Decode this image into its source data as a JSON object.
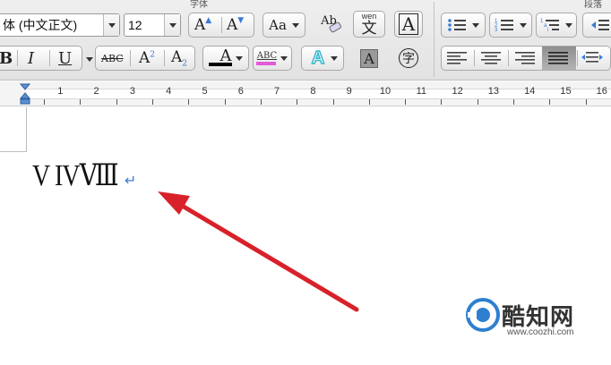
{
  "ribbon": {
    "font_group_title": "字体",
    "paragraph_group_title": "段落",
    "font_name": "体 (中文正文)",
    "font_size": "12",
    "grow_font": "A",
    "shrink_font": "A",
    "change_case": "Aa",
    "clear_format": "Ab",
    "phonetic_top": "wen",
    "phonetic_bottom": "文",
    "char_border": "A",
    "bold": "B",
    "italic": "I",
    "underline": "U",
    "strikethrough": "ABC",
    "superscript_base": "A",
    "superscript_mark": "2",
    "subscript_base": "A",
    "subscript_mark": "2",
    "font_color": "A",
    "highlight": "ABC",
    "text_effect": "A",
    "char_shading": "A",
    "enclose_char": "字"
  },
  "ruler": {
    "numbers": [
      "1",
      "2",
      "3",
      "4",
      "5",
      "6",
      "7",
      "8",
      "9",
      "10",
      "11",
      "12",
      "13",
      "14",
      "15",
      "16"
    ]
  },
  "document": {
    "text": "V IVⅧ",
    "paragraph_mark": "↵"
  },
  "watermark": {
    "name": "酷知网",
    "url": "www.coozhi.com"
  },
  "colors": {
    "font_color_bar": "#000000",
    "highlight_bar": "#e05bd6",
    "arrow": "#d8212a",
    "paragraph_mark": "#3a7bd5"
  }
}
